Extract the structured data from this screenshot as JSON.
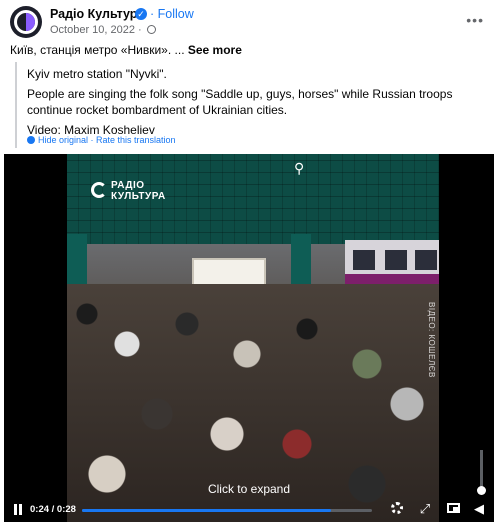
{
  "post": {
    "page_name": "Радіо Культура",
    "verified_mark": "✓",
    "follow_label": "· Follow",
    "date": "October 10, 2022 ·",
    "caption": "Київ, станція метро «Нивки». ...",
    "see_more": "See more",
    "more_menu": "•••"
  },
  "translation": {
    "line1": "Kyiv metro station \"Nyvki\".",
    "line2": "People are singing the folk song \"Saddle up, guys, horses\" while Russian troops continue rocket bombardment of Ukrainian cities.",
    "line3": "Video: Maxim Kosheliev",
    "actions": "Hide original · Rate this translation"
  },
  "video": {
    "logo_line1": "РАДІО",
    "logo_line2": "КУЛЬТУРА",
    "watermark": "ВІДЕО: КОШЕЛЄВ",
    "expand_hint": "Click to expand",
    "time": "0:24 / 0:28",
    "progress": 0.857,
    "accent": "#1877f2"
  },
  "icons": {
    "top_icon": "⚲"
  }
}
